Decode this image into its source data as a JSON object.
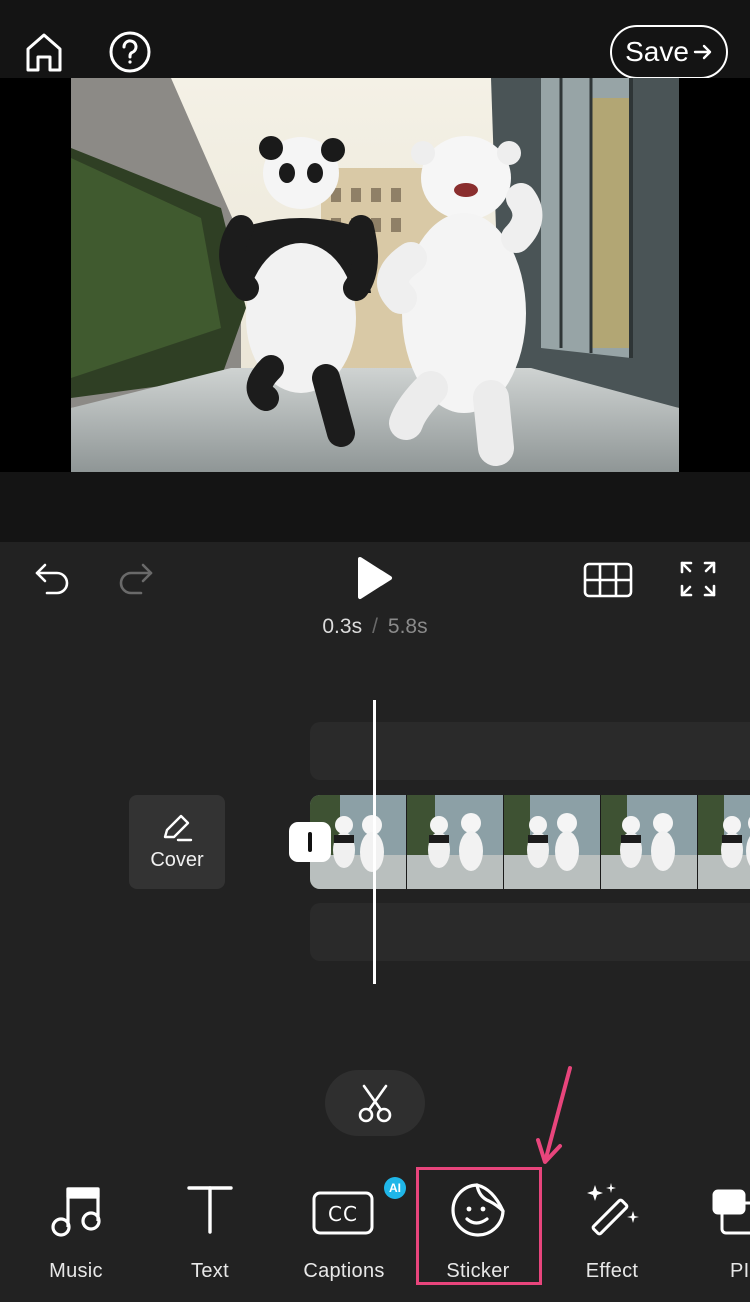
{
  "topbar": {
    "home_icon": "home-icon",
    "help_icon": "help-icon",
    "save_label": "Save"
  },
  "preview": {
    "description_icon": "video-preview"
  },
  "playback": {
    "current_time": "0.3s",
    "separator": "/",
    "total_time": "5.8s"
  },
  "timeline": {
    "cover_label": "Cover"
  },
  "toolbar": {
    "items": [
      {
        "label": "Music",
        "icon": "music-note-icon"
      },
      {
        "label": "Text",
        "icon": "text-icon"
      },
      {
        "label": "Captions",
        "icon": "captions-icon",
        "badge": "AI"
      },
      {
        "label": "Sticker",
        "icon": "sticker-icon"
      },
      {
        "label": "Effect",
        "icon": "magic-wand-icon"
      },
      {
        "label": "PI",
        "icon": "pip-icon"
      }
    ]
  },
  "colors": {
    "background": "#222222",
    "highlight": "#e8457c",
    "ai_badge": "#1fb6e8"
  }
}
